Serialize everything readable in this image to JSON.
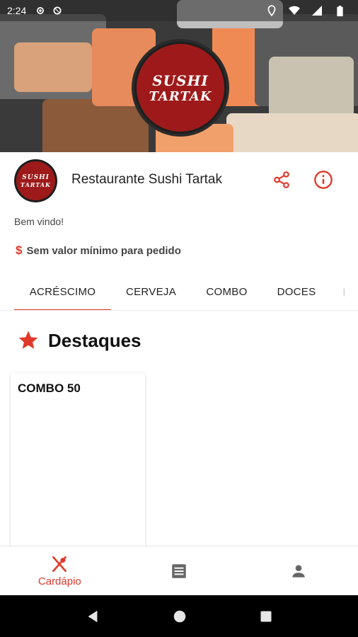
{
  "status_bar": {
    "time": "2:24"
  },
  "banner": {
    "logo_line1": "SUSHI",
    "logo_line2": "TARTAK"
  },
  "header": {
    "restaurant_name": "Restaurante Sushi Tartak",
    "logo_line1": "SUSHI",
    "logo_line2": "TARTAK"
  },
  "info": {
    "welcome": "Bem vindo!",
    "currency_symbol": "$",
    "min_order": "Sem valor mínimo para pedido"
  },
  "tabs": [
    {
      "label": "ACRÉSCIMO",
      "active": true
    },
    {
      "label": "CERVEJA",
      "active": false
    },
    {
      "label": "COMBO",
      "active": false
    },
    {
      "label": "DOCES",
      "active": false
    }
  ],
  "highlights": {
    "title": "Destaques",
    "items": [
      {
        "name": "COMBO 50"
      }
    ]
  },
  "bottom_nav": {
    "items": [
      {
        "label": "Cardápio",
        "icon": "utensils-icon",
        "active": true
      },
      {
        "label": "",
        "icon": "list-icon",
        "active": false
      },
      {
        "label": "",
        "icon": "person-icon",
        "active": false
      }
    ]
  },
  "colors": {
    "accent": "#e0392b",
    "logo_red": "#9e1a1a"
  }
}
